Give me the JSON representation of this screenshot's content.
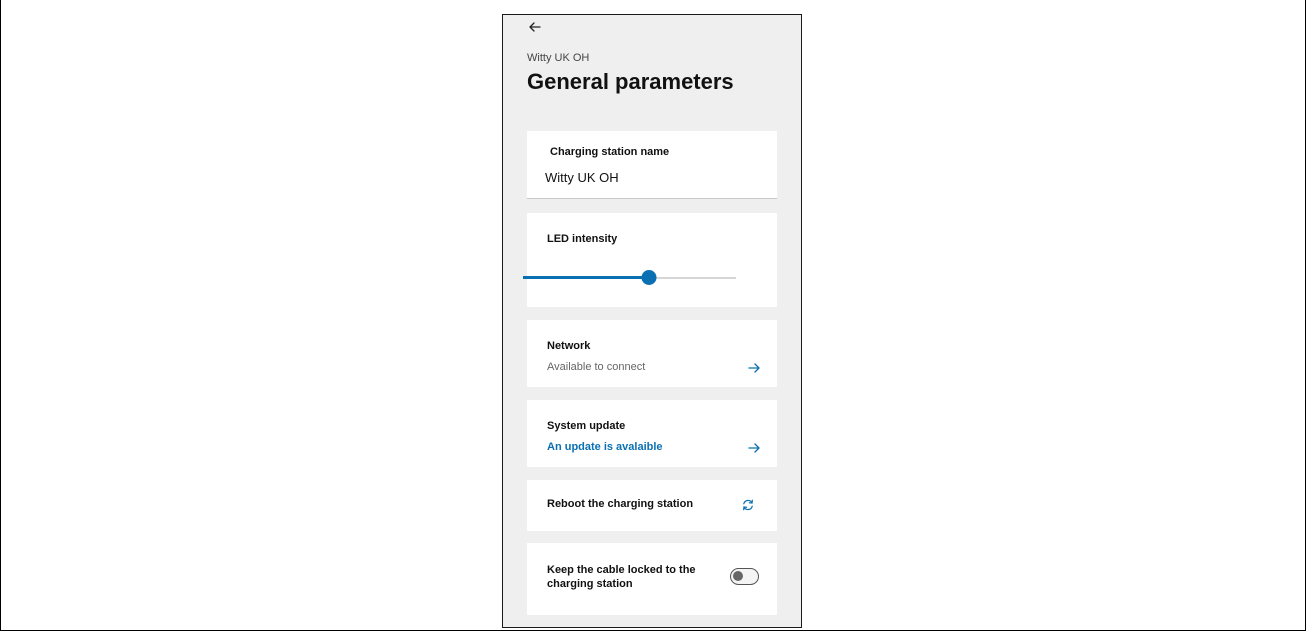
{
  "header": {
    "back_icon": "arrow-left-icon",
    "station_label": "Witty UK OH",
    "title": "General parameters"
  },
  "station_name": {
    "label": "Charging station name",
    "value": "Witty UK OH"
  },
  "led_intensity": {
    "label": "LED intensity",
    "level_fraction": 0.59,
    "accent_color": "#0a70b2"
  },
  "network": {
    "label": "Network",
    "status": "Available to connect",
    "icon": "arrow-right-icon"
  },
  "system_update": {
    "label": "System update",
    "status": "An update is avalaible",
    "status_color": "#0a70b2",
    "icon": "arrow-right-icon"
  },
  "reboot": {
    "label": "Reboot the charging station",
    "icon": "refresh-icon"
  },
  "cable_lock": {
    "label": "Keep the cable locked to the charging station",
    "enabled": false
  }
}
